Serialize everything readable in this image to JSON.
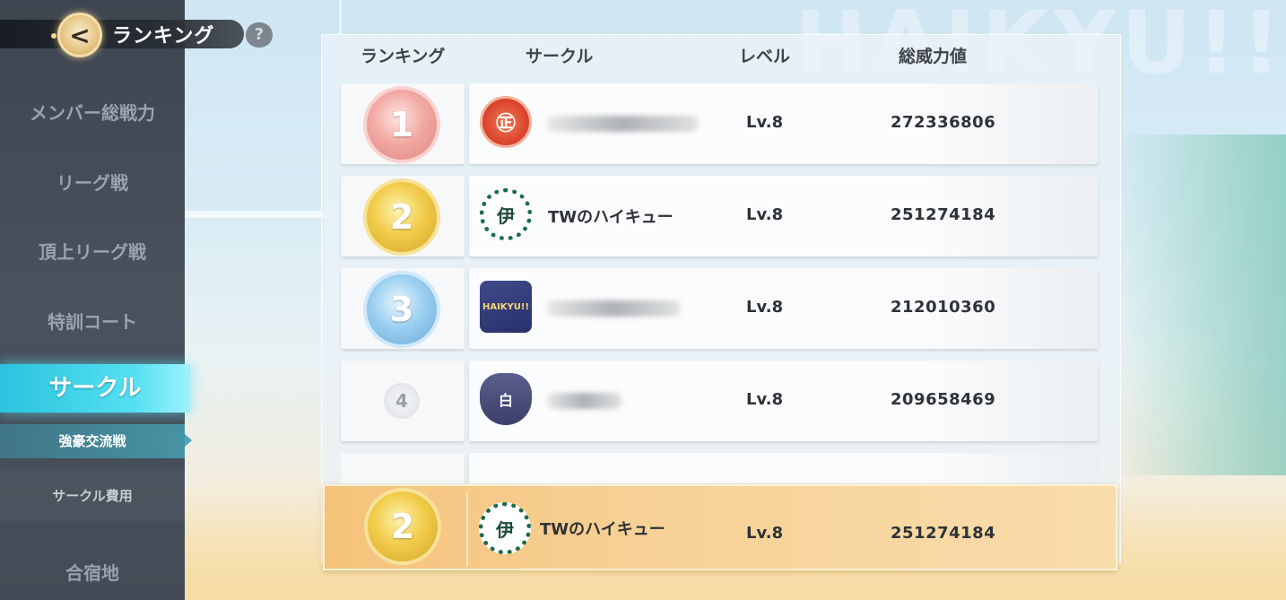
{
  "header": {
    "title": "ランキング",
    "back_icon": "back-arrow-icon",
    "help_label": "?"
  },
  "sidebar": {
    "items": [
      {
        "label": "メンバー総戦力"
      },
      {
        "label": "リーグ戦"
      },
      {
        "label": "頂上リーグ戦"
      },
      {
        "label": "特訓コート"
      },
      {
        "label": "サークル",
        "active": true
      },
      {
        "label": "強豪交流戦",
        "sub": true,
        "selected": true
      },
      {
        "label": "サークル費用",
        "sub": true
      },
      {
        "label": "合宿地"
      }
    ]
  },
  "table": {
    "headers": {
      "rank": "ランキング",
      "circle": "サークル",
      "level": "レベル",
      "power": "総威力値"
    },
    "rows": [
      {
        "rank": "1",
        "name": "",
        "level": "Lv.8",
        "power": "272336806",
        "emblem": "red-seal-emblem",
        "emblem_text": "㊣"
      },
      {
        "rank": "2",
        "name": "TWのハイキュー",
        "level": "Lv.8",
        "power": "251274184",
        "emblem": "date-tech-emblem",
        "emblem_text": "伊"
      },
      {
        "rank": "3",
        "name": "",
        "level": "Lv.8",
        "power": "212010360",
        "emblem": "haikyu-crest-emblem",
        "emblem_text": "HAIKYU!!"
      },
      {
        "rank": "4",
        "name": "",
        "level": "Lv.8",
        "power": "209658469",
        "emblem": "shiratorizawa-emblem",
        "emblem_text": "白"
      }
    ],
    "my_row": {
      "rank": "2",
      "name": "TWのハイキュー",
      "level": "Lv.8",
      "power": "251274184",
      "emblem_text": "伊"
    }
  },
  "colors": {
    "accent": "#2bc3de",
    "sidebar_bg": "#454d58",
    "my_row": "#f5c27a"
  }
}
